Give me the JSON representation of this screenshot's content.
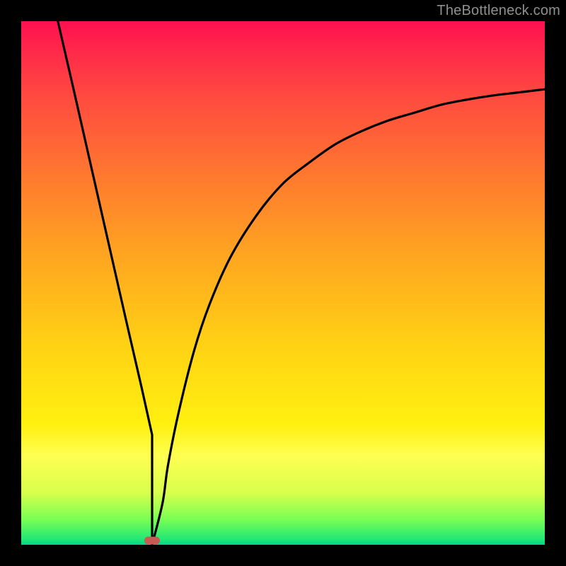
{
  "watermark": "TheBottleneck.com",
  "colors": {
    "frame": "#000000",
    "curve": "#000000",
    "marker": "#c85a54",
    "gradient_top": "#ff1050",
    "gradient_bottom": "#00d78a"
  },
  "chart_data": {
    "type": "line",
    "title": "",
    "xlabel": "",
    "ylabel": "",
    "xlim": [
      0,
      100
    ],
    "ylim": [
      0,
      100
    ],
    "grid": false,
    "series": [
      {
        "name": "left-branch",
        "x": [
          7,
          10,
          15,
          20,
          23,
          25
        ],
        "y": [
          100,
          87,
          65,
          43,
          30,
          21
        ]
      },
      {
        "name": "right-branch",
        "x": [
          25,
          27,
          28,
          30,
          33,
          36,
          40,
          45,
          50,
          55,
          60,
          65,
          70,
          75,
          80,
          85,
          90,
          95,
          100
        ],
        "y": [
          0,
          8,
          15,
          25,
          37,
          46,
          55,
          63,
          69,
          73,
          76.5,
          79,
          81,
          82.5,
          84,
          85,
          85.8,
          86.4,
          87
        ]
      }
    ],
    "vertex": {
      "x": 25,
      "y": 0
    },
    "marker": {
      "x": 25,
      "y": 0.8
    },
    "annotations": []
  }
}
